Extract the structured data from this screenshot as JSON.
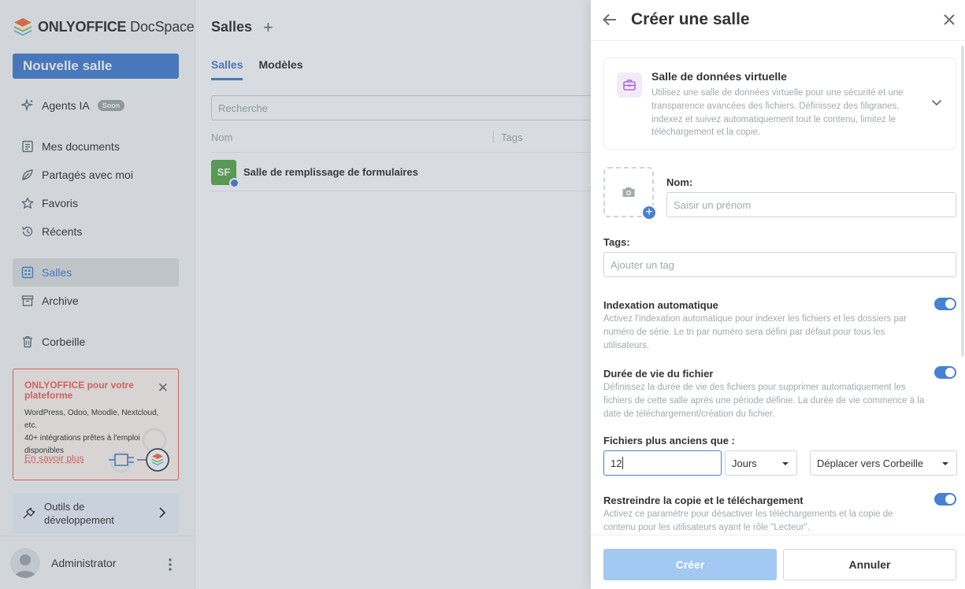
{
  "app": {
    "logo_brand": "ONLYOFFICE",
    "logo_product": "DocSpace",
    "accent": "#4781d1"
  },
  "sidebar": {
    "new_room_label": "Nouvelle salle",
    "ai_agents": {
      "label": "Agents IA",
      "badge": "Soon"
    },
    "items": [
      {
        "label": "Mes documents",
        "icon": "document-icon"
      },
      {
        "label": "Partagés avec moi",
        "icon": "shared-icon"
      },
      {
        "label": "Favoris",
        "icon": "star-icon"
      },
      {
        "label": "Récents",
        "icon": "history-icon"
      },
      {
        "label": "Salles",
        "icon": "rooms-icon",
        "active": true
      },
      {
        "label": "Archive",
        "icon": "archive-icon"
      },
      {
        "label": "Corbeille",
        "icon": "trash-icon"
      }
    ],
    "promo": {
      "title": "ONLYOFFICE pour votre plateforme",
      "line1": "WordPress, Odoo, Moodle, Nextcloud, etc.",
      "line2": "40+ intégrations prêtes à l'emploi disponibles",
      "link": "En savoir plus"
    },
    "devtools_label": "Outils de développement",
    "user_name": "Administrator"
  },
  "main": {
    "title": "Salles",
    "tabs": [
      {
        "label": "Salles",
        "active": true
      },
      {
        "label": "Modèles",
        "active": false
      }
    ],
    "search_placeholder": "Recherche",
    "columns": {
      "name": "Nom",
      "tags": "Tags"
    },
    "rows": [
      {
        "initials": "SF",
        "name": "Salle de remplissage de formulaires",
        "color": "#5aab4f"
      }
    ]
  },
  "panel": {
    "title": "Créer une salle",
    "room_type": {
      "title": "Salle de données virtuelle",
      "description": "Utilisez une salle de données virtuelle pour une sécurité et une transparence avancées des fichiers. Définissez des filigranes, indexez et suivez automatiquement tout le contenu, limitez le téléchargement et la copie."
    },
    "name_label": "Nom:",
    "name_placeholder": "Saisir un prénom",
    "tags_label": "Tags:",
    "tags_placeholder": "Ajouter un tag",
    "options": [
      {
        "title": "Indexation automatique",
        "description": "Activez l'indexation automatique pour indexer les fichiers et les dossiers par numéro de série. Le tri par numéro sera défini par défaut pour tous les utilisateurs.",
        "enabled": true
      },
      {
        "title": "Durée de vie du fichier",
        "description": "Définissez la durée de vie des fichiers pour supprimer automatiquement les fichiers de cette salle après une période définie. La durée de vie commence à la date de téléchargement/création du fichier.",
        "enabled": true
      },
      {
        "title": "Restreindre la copie et le téléchargement",
        "description": "Activez ce paramètre pour désactiver les téléchargements et la copie de contenu pour les utilisateurs ayant le rôle \"Lecteur\".",
        "enabled": true
      }
    ],
    "lifetime": {
      "label": "Fichiers plus anciens que :",
      "value": "12",
      "unit": "Jours",
      "action": "Déplacer vers Corbeille"
    },
    "create_label": "Créer",
    "cancel_label": "Annuler"
  }
}
